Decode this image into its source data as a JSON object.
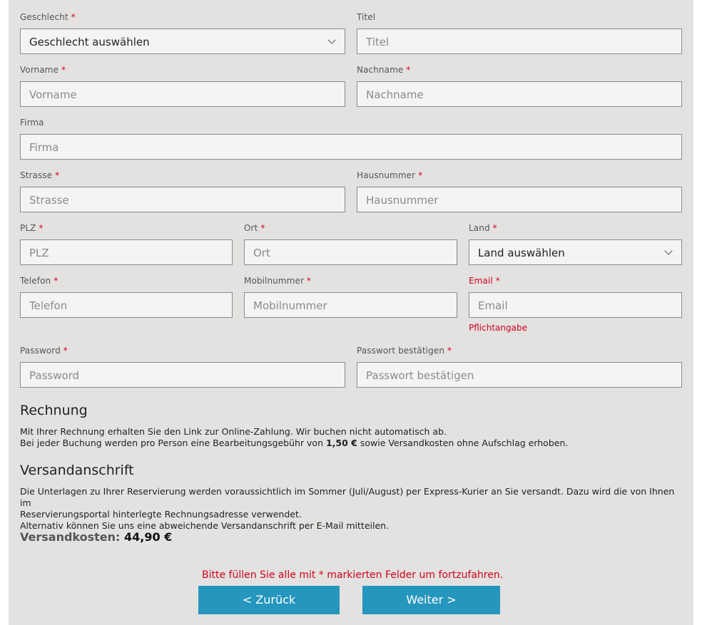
{
  "form": {
    "required_marker": "*",
    "salutation": {
      "label": "Geschlecht",
      "value": "Geschlecht auswählen"
    },
    "title": {
      "label": "Titel",
      "placeholder": "Titel"
    },
    "firstname": {
      "label": "Vorname",
      "placeholder": "Vorname"
    },
    "lastname": {
      "label": "Nachname",
      "placeholder": "Nachname"
    },
    "company": {
      "label": "Firma",
      "placeholder": "Firma"
    },
    "street": {
      "label": "Strasse",
      "placeholder": "Strasse"
    },
    "housenumber": {
      "label": "Hausnummer",
      "placeholder": "Hausnummer"
    },
    "zip": {
      "label": "PLZ",
      "placeholder": "PLZ"
    },
    "city": {
      "label": "Ort",
      "placeholder": "Ort"
    },
    "country": {
      "label": "Land",
      "value": "Land auswählen"
    },
    "phone": {
      "label": "Telefon",
      "placeholder": "Telefon"
    },
    "mobile": {
      "label": "Mobilnummer",
      "placeholder": "Mobilnummer"
    },
    "email": {
      "label": "Email",
      "placeholder": "Email",
      "error": "Pflichtangabe"
    },
    "password": {
      "label": "Password",
      "placeholder": "Password"
    },
    "password_confirm": {
      "label": "Passwort bestätigen",
      "placeholder": "Passwort bestätigen"
    }
  },
  "invoice": {
    "heading": "Rechnung",
    "line1": "Mit Ihrer Rechnung erhalten Sie den Link zur Online-Zahlung. Wir buchen nicht automatisch ab.",
    "line2_pre": "Bei jeder Buchung werden pro Person eine Bearbeitungsgebühr von",
    "line2_fee": "1,50 €",
    "line2_post": "sowie Versandkosten ohne Aufschlag erhoben."
  },
  "shipping": {
    "heading": "Versandanschrift",
    "line1": "Die Unterlagen zu Ihrer Reservierung werden voraussichtlich im Sommer (Juli/August) per Express-Kurier an Sie versandt. Dazu wird die von Ihnen im",
    "line2": "Reservierungsportal hinterlegte Rechnungsadresse verwendet.",
    "line3": "Alternativ können Sie uns eine abweichende Versandanschrift per E-Mail mitteilen.",
    "cost_label": "Versandkosten:",
    "cost_value": "44,90 €"
  },
  "footer": {
    "warning": "Bitte füllen Sie alle mit * markierten Felder um fortzufahren.",
    "back_label": "< Zurück",
    "next_label": "Weiter >"
  },
  "colors": {
    "accent": "#2596be",
    "error": "#d0021b",
    "panel": "#e3e2e0"
  }
}
